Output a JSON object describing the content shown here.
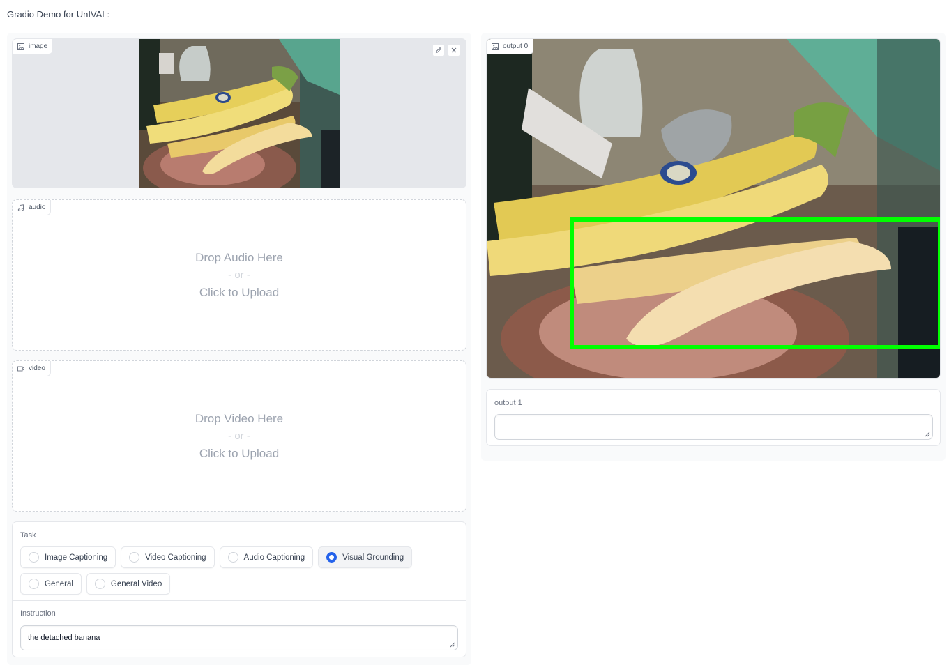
{
  "page": {
    "title": "Gradio Demo for UnIVAL:"
  },
  "inputs": {
    "image": {
      "label": "image"
    },
    "audio": {
      "label": "audio",
      "drop_text": "Drop Audio Here",
      "or_text": "- or -",
      "upload_text": "Click to Upload"
    },
    "video": {
      "label": "video",
      "drop_text": "Drop Video Here",
      "or_text": "- or -",
      "upload_text": "Click to Upload"
    },
    "task": {
      "label": "Task",
      "options": [
        {
          "label": "Image Captioning",
          "selected": false
        },
        {
          "label": "Video Captioning",
          "selected": false
        },
        {
          "label": "Audio Captioning",
          "selected": false
        },
        {
          "label": "Visual Grounding",
          "selected": true
        },
        {
          "label": "General",
          "selected": false
        },
        {
          "label": "General Video",
          "selected": false
        }
      ]
    },
    "instruction": {
      "label": "Instruction",
      "value": "the detached banana"
    }
  },
  "outputs": {
    "output0": {
      "label": "output 0",
      "box_color": "#00ff00"
    },
    "output1": {
      "label": "output 1",
      "value": ""
    }
  },
  "colors": {
    "accent": "#2563eb",
    "panel_bg": "#f9fafb",
    "border": "#e5e7eb"
  },
  "icons": [
    "image-icon",
    "music-note-icon",
    "video-camera-icon",
    "pencil-icon",
    "close-icon"
  ]
}
